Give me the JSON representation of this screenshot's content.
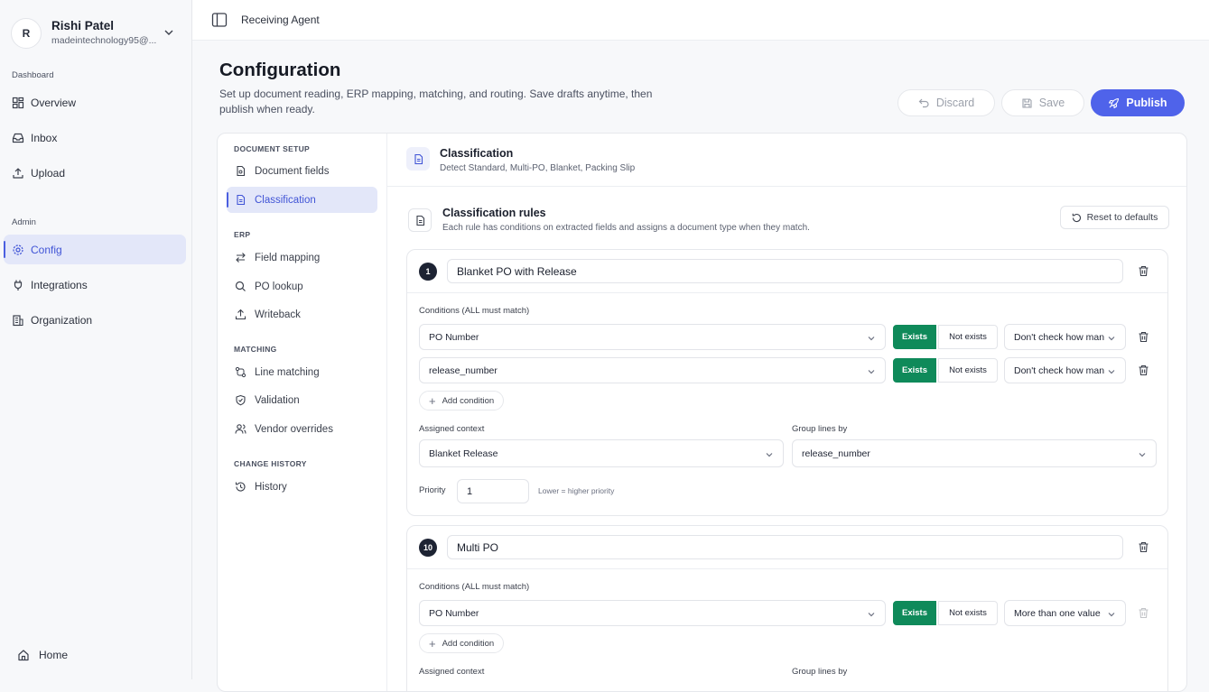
{
  "user": {
    "initial": "R",
    "name": "Rishi Patel",
    "email": "madeintechnology95@..."
  },
  "sidebar": {
    "dashboard_label": "Dashboard",
    "dashboard_items": [
      {
        "label": "Overview",
        "icon": "grid-icon"
      },
      {
        "label": "Inbox",
        "icon": "inbox-icon"
      },
      {
        "label": "Upload",
        "icon": "upload-icon"
      }
    ],
    "admin_label": "Admin",
    "admin_items": [
      {
        "label": "Config",
        "icon": "gear-icon",
        "active": true
      },
      {
        "label": "Integrations",
        "icon": "plug-icon"
      },
      {
        "label": "Organization",
        "icon": "building-icon"
      }
    ],
    "home_label": "Home"
  },
  "topbar": {
    "title": "Receiving Agent"
  },
  "page": {
    "title": "Configuration",
    "subtitle": "Set up document reading, ERP mapping, matching, and routing. Save drafts anytime, then publish when ready.",
    "discard_label": "Discard",
    "save_label": "Save",
    "publish_label": "Publish"
  },
  "subnav": {
    "sections": [
      {
        "label": "DOCUMENT SETUP",
        "items": [
          {
            "label": "Document fields"
          },
          {
            "label": "Classification",
            "active": true
          }
        ]
      },
      {
        "label": "ERP",
        "items": [
          {
            "label": "Field mapping"
          },
          {
            "label": "PO lookup"
          },
          {
            "label": "Writeback"
          }
        ]
      },
      {
        "label": "MATCHING",
        "items": [
          {
            "label": "Line matching"
          },
          {
            "label": "Validation"
          },
          {
            "label": "Vendor overrides"
          }
        ]
      },
      {
        "label": "CHANGE HISTORY",
        "items": [
          {
            "label": "History"
          }
        ]
      }
    ]
  },
  "classification": {
    "title": "Classification",
    "desc": "Detect Standard, Multi-PO, Blanket, Packing Slip",
    "rules_title": "Classification rules",
    "rules_desc": "Each rule has conditions on extracted fields and assigns a document type when they match.",
    "reset_label": "Reset to defaults",
    "conditions_label": "Conditions (ALL must match)",
    "add_condition_label": "Add condition",
    "assigned_context_label": "Assigned context",
    "group_lines_label": "Group lines by",
    "priority_label": "Priority",
    "priority_hint": "Lower = higher priority",
    "exists_label": "Exists",
    "not_exists_label": "Not exists",
    "rules": [
      {
        "number": "1",
        "name": "Blanket PO with Release",
        "conditions": [
          {
            "field": "PO Number",
            "count": "Don't check how many"
          },
          {
            "field": "release_number",
            "count": "Don't check how many"
          }
        ],
        "assigned_context": "Blanket Release",
        "group_by": "release_number",
        "priority": "1"
      },
      {
        "number": "10",
        "name": "Multi PO",
        "conditions": [
          {
            "field": "PO Number",
            "count": "More than one value"
          }
        ]
      }
    ]
  }
}
